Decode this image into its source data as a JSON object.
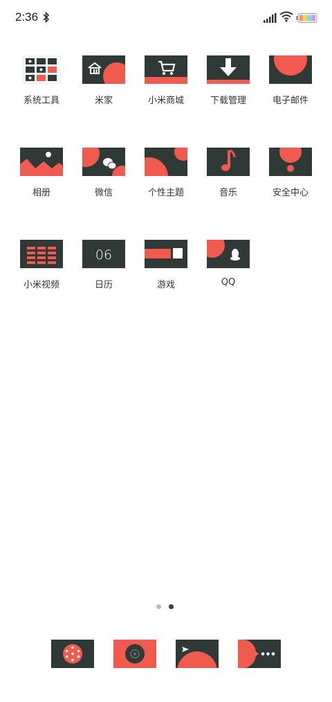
{
  "status_bar": {
    "time": "2:36",
    "icons": [
      "bluetooth-icon",
      "signal-icon",
      "wifi-icon",
      "battery-icon"
    ]
  },
  "apps": [
    {
      "label": "系统工具",
      "icon": "system-tools-folder-icon"
    },
    {
      "label": "米家",
      "icon": "mijia-home-icon"
    },
    {
      "label": "小米商城",
      "icon": "shopping-cart-icon"
    },
    {
      "label": "下载管理",
      "icon": "download-arrow-icon"
    },
    {
      "label": "电子邮件",
      "icon": "email-icon"
    },
    {
      "label": "相册",
      "icon": "gallery-mountain-icon"
    },
    {
      "label": "微信",
      "icon": "wechat-icon"
    },
    {
      "label": "个性主题",
      "icon": "themes-icon"
    },
    {
      "label": "音乐",
      "icon": "music-note-icon"
    },
    {
      "label": "安全中心",
      "icon": "security-icon"
    },
    {
      "label": "小米视频",
      "icon": "video-icon"
    },
    {
      "label": "日历",
      "icon": "calendar-icon",
      "text": "06"
    },
    {
      "label": "游戏",
      "icon": "game-icon"
    },
    {
      "label": "QQ",
      "icon": "qq-penguin-icon"
    }
  ],
  "pager": {
    "pages": 2,
    "current": 2
  },
  "dock": [
    {
      "icon": "phone-dialpad-icon"
    },
    {
      "icon": "camera-lens-icon"
    },
    {
      "icon": "messages-send-icon"
    },
    {
      "icon": "more-apps-icon"
    }
  ],
  "colors": {
    "tile_dark": "#2f3a37",
    "accent": "#f05a4f",
    "background": "#ffffff"
  }
}
